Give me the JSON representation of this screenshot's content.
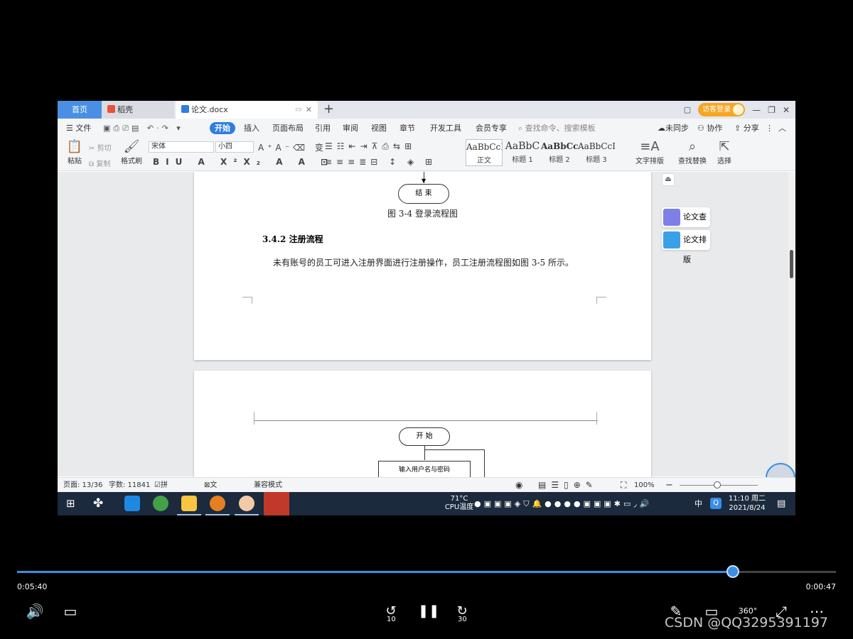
{
  "titlebar": {
    "tab_home": "首页",
    "tab_daoke": "稻壳",
    "tab_doc": "论文.docx",
    "new_tab": "+",
    "login": "访客登录"
  },
  "menu": {
    "file": "文件",
    "items": [
      "开始",
      "插入",
      "页面布局",
      "引用",
      "审阅",
      "视图",
      "章节",
      "开发工具",
      "会员专享"
    ],
    "search_placeholder": "查找命令、搜索模板",
    "sync": "未同步",
    "collab": "协作",
    "share": "分享"
  },
  "ribbon": {
    "paste": "粘贴",
    "cut": "剪切",
    "copy": "复制",
    "format_painter": "格式刷",
    "font_name": "宋体",
    "font_size": "小四",
    "styles": [
      {
        "sample": "AaBbCcI",
        "name": "正文"
      },
      {
        "sample": "AaBbC",
        "name": "标题 1"
      },
      {
        "sample": "AaBbCc",
        "name": "标题 2"
      },
      {
        "sample": "AaBbCcI",
        "name": "标题 3"
      }
    ],
    "text_layout": "文字排版",
    "find_replace": "查找替换",
    "select": "选择"
  },
  "document": {
    "end_node": "结 束",
    "caption": "图 3-4  登录流程图",
    "heading": "3.4.2 注册流程",
    "paragraph": "未有账号的员工可进入注册界面进行注册操作，员工注册流程图如图 3-5 所示。",
    "start_node": "开 始",
    "input_box": "输入用户名与密码"
  },
  "side_panel": {
    "check": "论文查重",
    "layout": "论文排版"
  },
  "statusbar": {
    "page": "页面: 13/36",
    "words": "字数: 11841",
    "spell": "拼写检查",
    "proof": "文档校对",
    "compat": "兼容模式",
    "zoom": "100%"
  },
  "taskbar": {
    "cpu": "CPU温度",
    "cpu_temp": "71°C",
    "ime": "中",
    "time": "11:10 周二",
    "date": "2021/8/24"
  },
  "player": {
    "elapsed": "0:05:40",
    "remaining": "0:00:47",
    "progress": 0.874,
    "rewind": "10",
    "forward": "30",
    "vr": "360°",
    "watermark": "CSDN @QQ3295391197"
  },
  "colors": {
    "accent": "#2f7de1",
    "progress": "#3a8ee6",
    "login": "#f5a623"
  }
}
